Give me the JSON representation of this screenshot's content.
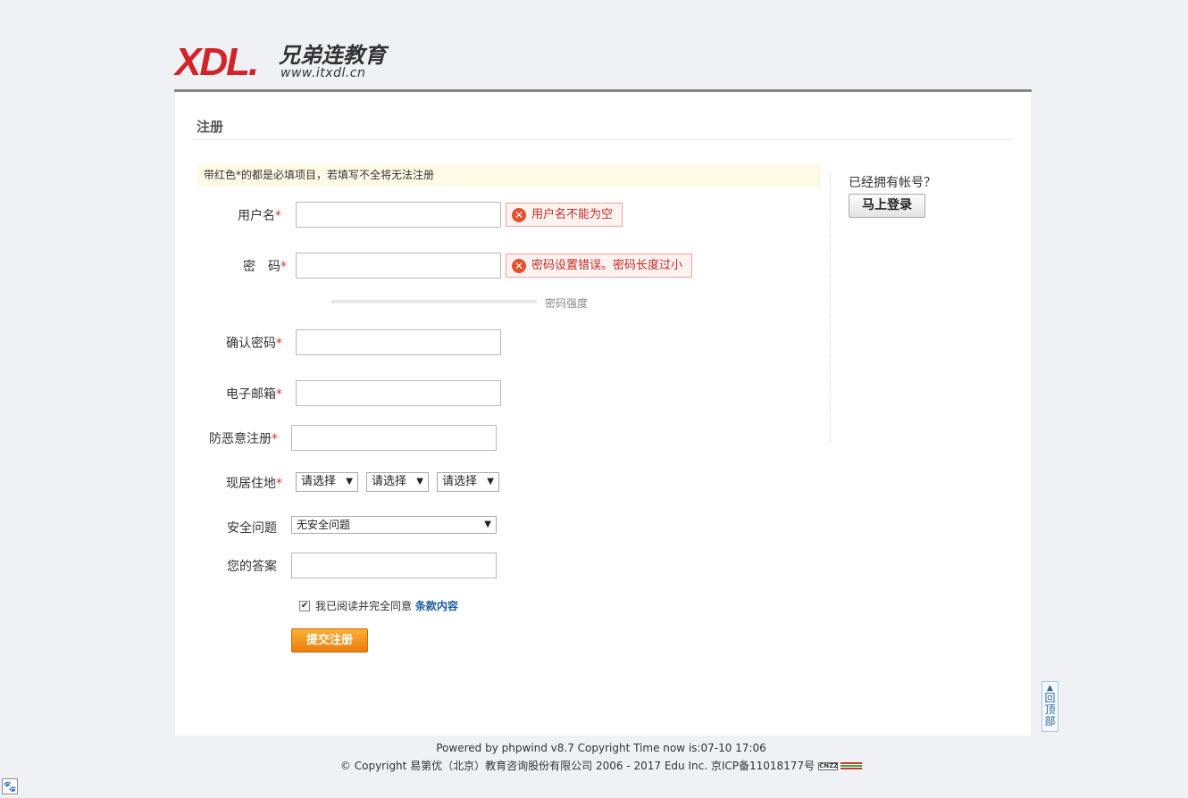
{
  "logo": {
    "brand": "XDL.",
    "name_cn": "兄弟连教育",
    "url": "www.itxdl.cn"
  },
  "page_title": "注册",
  "notice": "带红色*的都是必填项目，若填写不全将无法注册",
  "side": {
    "question": "已经拥有帐号？",
    "login_button": "马上登录"
  },
  "required_mark": "*",
  "fields": {
    "username": {
      "label": "用户名",
      "error": "用户名不能为空"
    },
    "password": {
      "label": "密　码",
      "error": "密码设置错误。密码长度过小",
      "strength_label": "密码强度"
    },
    "confirm": {
      "label": "确认密码"
    },
    "email": {
      "label": "电子邮箱"
    },
    "captcha": {
      "label": "防恶意注册"
    },
    "residence": {
      "label": "现居住地",
      "selects": [
        "请选择",
        "请选择",
        "请选择"
      ]
    },
    "security_question": {
      "label": "安全问题",
      "selected": "无安全问题"
    },
    "answer": {
      "label": "您的答案"
    }
  },
  "agree": {
    "text": "我已阅读并完全同意",
    "link": "条款内容"
  },
  "submit_label": "提交注册",
  "back_to_top": "回顶部",
  "footer": {
    "line1": "Powered by phpwind v8.7 Copyright Time now is:07-10 17:06",
    "line2": "© Copyright 易第优（北京）教育咨询股份有限公司 2006 - 2017 Edu Inc. 京ICP备11018177号",
    "cnzz": "CNZZ"
  }
}
